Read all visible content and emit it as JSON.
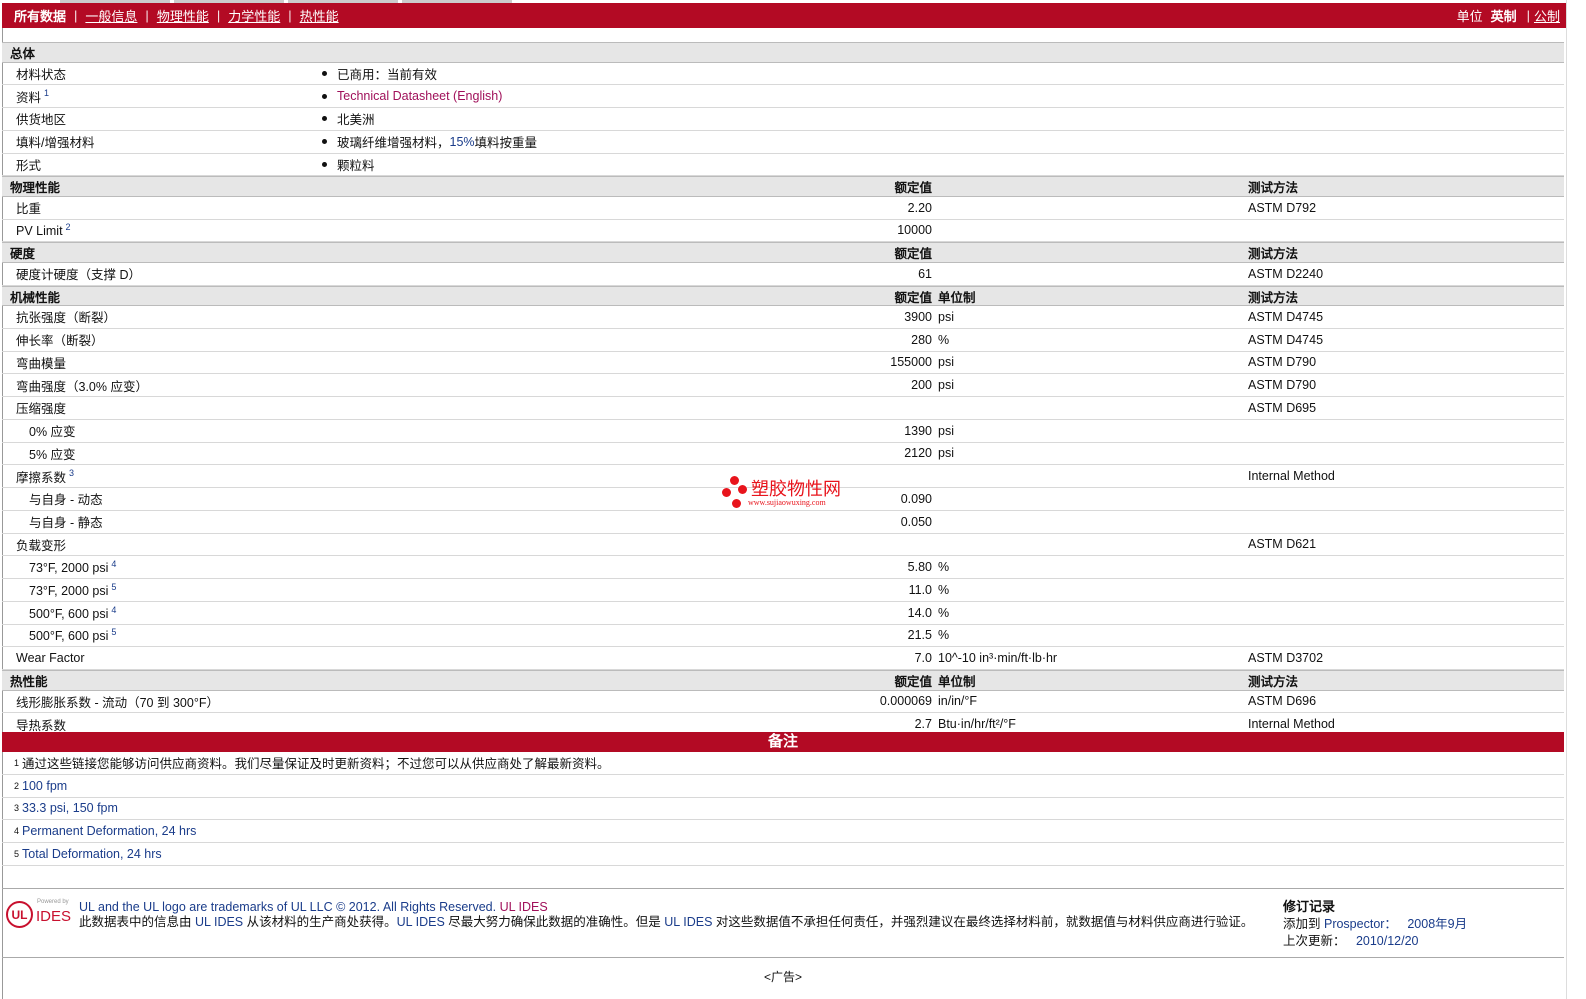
{
  "nav": {
    "current": "所有数据",
    "links": [
      "一般信息",
      "物理性能",
      "力学性能",
      "热性能"
    ],
    "units_label": "单位",
    "unit_current": "英制",
    "unit_other": "公制"
  },
  "general": {
    "title": "总体",
    "rows": [
      {
        "label": "材料状态",
        "value": "已商用：当前有效"
      },
      {
        "label": "资料",
        "sup": "1",
        "value": "Technical Datasheet (English)",
        "link": true
      },
      {
        "label": "供货地区",
        "value": "北美洲"
      },
      {
        "label": "填料/增强材料",
        "value_a": "玻璃纤维增强材料，",
        "value_b": "15%",
        "value_c": " 填料按重量"
      },
      {
        "label": "形式",
        "value": "颗粒料"
      }
    ]
  },
  "sections": [
    {
      "title": "物理性能",
      "col_value": "额定值",
      "col_unit": "",
      "col_method": "测试方法",
      "rows": [
        {
          "label": "比重",
          "value": "2.20",
          "unit": "",
          "method": "ASTM D792"
        },
        {
          "label": "PV Limit",
          "sup": "2",
          "value": "10000",
          "unit": "",
          "method": ""
        }
      ]
    },
    {
      "title": "硬度",
      "col_value": "额定值",
      "col_unit": "",
      "col_method": "测试方法",
      "rows": [
        {
          "label": "硬度计硬度（支撑 D）",
          "value": "61",
          "unit": "",
          "method": "ASTM D2240"
        }
      ]
    },
    {
      "title": "机械性能",
      "col_value": "额定值",
      "col_unit": "单位制",
      "col_method": "测试方法",
      "rows": [
        {
          "label": "抗张强度（断裂）",
          "value": "3900",
          "unit": "psi",
          "method": "ASTM D4745"
        },
        {
          "label": "伸长率（断裂）",
          "value": "280",
          "unit": "%",
          "method": "ASTM D4745"
        },
        {
          "label": "弯曲模量",
          "value": "155000",
          "unit": "psi",
          "method": "ASTM D790"
        },
        {
          "label": "弯曲强度（3.0% 应变）",
          "value": "200",
          "unit": "psi",
          "method": "ASTM D790"
        },
        {
          "label": "压缩强度",
          "value": "",
          "unit": "",
          "method": "ASTM D695"
        },
        {
          "label": "0% 应变",
          "indent": true,
          "value": "1390",
          "unit": "psi",
          "method": ""
        },
        {
          "label": "5% 应变",
          "indent": true,
          "value": "2120",
          "unit": "psi",
          "method": ""
        },
        {
          "label": "摩擦系数",
          "sup": "3",
          "value": "",
          "unit": "",
          "method": "Internal Method"
        },
        {
          "label": "与自身 - 动态",
          "indent": true,
          "value": "0.090",
          "unit": "",
          "method": ""
        },
        {
          "label": "与自身 - 静态",
          "indent": true,
          "value": "0.050",
          "unit": "",
          "method": ""
        },
        {
          "label": "负载变形",
          "value": "",
          "unit": "",
          "method": "ASTM D621"
        },
        {
          "label": "73°F, 2000 psi",
          "sup": "4",
          "indent": true,
          "value": "5.80",
          "unit": "%",
          "method": ""
        },
        {
          "label": "73°F, 2000 psi",
          "sup": "5",
          "indent": true,
          "value": "11.0",
          "unit": "%",
          "method": ""
        },
        {
          "label": "500°F, 600 psi",
          "sup": "4",
          "indent": true,
          "value": "14.0",
          "unit": "%",
          "method": ""
        },
        {
          "label": "500°F, 600 psi",
          "sup": "5",
          "indent": true,
          "value": "21.5",
          "unit": "%",
          "method": ""
        },
        {
          "label": "Wear Factor",
          "value": "7.0",
          "unit": "10^-10 in³·min/ft·lb·hr",
          "method": "ASTM D3702"
        }
      ]
    },
    {
      "title": "热性能",
      "col_value": "额定值",
      "col_unit": "单位制",
      "col_method": "测试方法",
      "rows": [
        {
          "label": "线形膨胀系数 - 流动（70 到 300°F）",
          "value": "0.000069",
          "unit": "in/in/°F",
          "method": "ASTM D696"
        },
        {
          "label": "导热系数",
          "value": "2.7",
          "unit": "Btu·in/hr/ft²/°F",
          "method": "Internal Method"
        }
      ]
    }
  ],
  "notes": {
    "title": "备注",
    "items": [
      {
        "n": "1",
        "text": "通过这些链接您能够访问供应商资料。我们尽量保证及时更新资料；不过您可以从供应商处了解最新资料。"
      },
      {
        "n": "2",
        "text": "100 fpm"
      },
      {
        "n": "3",
        "text": "33.3 psi, 150 fpm"
      },
      {
        "n": "4",
        "text": "Permanent Deformation, 24 hrs"
      },
      {
        "n": "5",
        "text": "Total Deformation, 24 hrs"
      }
    ]
  },
  "footer": {
    "logo_powered": "Powered by",
    "logo_ul": "UL",
    "logo_ides": "IDES",
    "line1": "UL and the UL logo are trademarks of UL LLC © 2012. All Rights Reserved.",
    "line1_link": "UL IDES",
    "p1": "此数据表中的信息由 ",
    "ul_ides": "UL IDES",
    "p2": " 从该材料的生产商处获得。",
    "p3": " 尽最大努力确保此数据的准确性。但是 ",
    "p4": " 对这些数据值不承担任何责任，并强烈建议在最终选择材料前，就数据值与材料供应商进行验证。",
    "rev_title": "修订记录",
    "added_label": "添加到 ",
    "prospector": "Prospector：",
    "added_date": "2008年9月",
    "updated_label": "上次更新：",
    "updated_date": "2010/12/20"
  },
  "ad": "<广告>",
  "watermark": {
    "name": "塑胶物性网",
    "url": "www.sujiaowuxing.com"
  }
}
